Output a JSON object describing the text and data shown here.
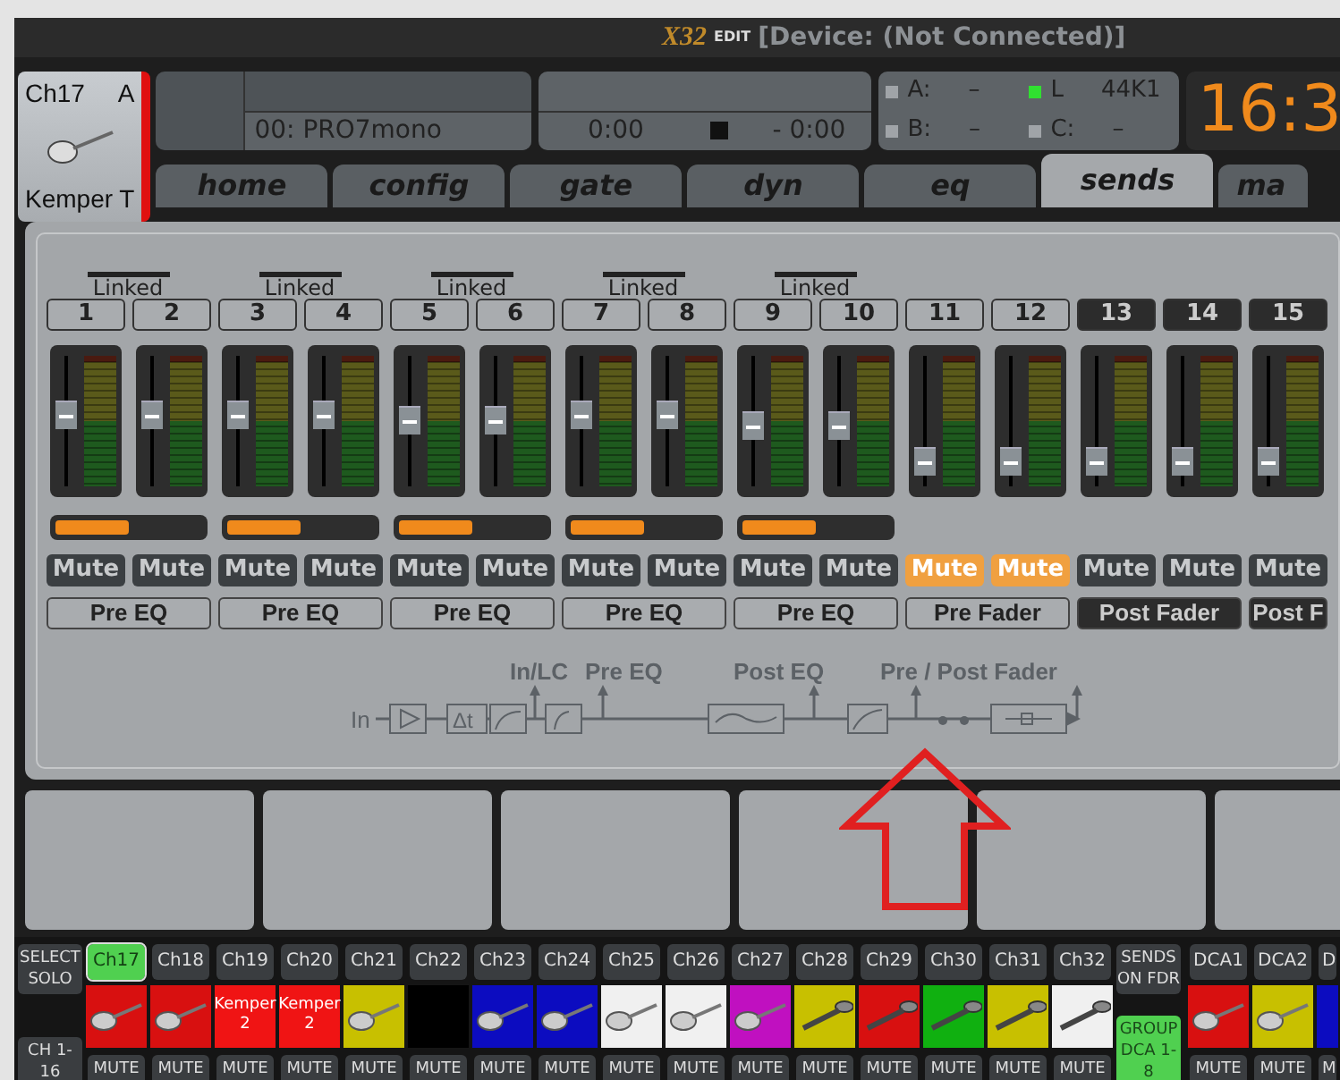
{
  "title_bar": {
    "logo": "X32",
    "logo_sub": "EDIT",
    "title": "[Device: (Not Connected)]"
  },
  "channel": {
    "name": "Ch17",
    "letter": "A",
    "label": "Kemper T"
  },
  "scene": {
    "name": "00: PRO7mono"
  },
  "transport": {
    "elapsed": "0:00",
    "remaining": "- 0:00"
  },
  "status": [
    {
      "label": "A:",
      "value": "–",
      "on": false
    },
    {
      "label": "L",
      "value": "44K1",
      "on": true
    },
    {
      "label": "B:",
      "value": "–",
      "on": false
    },
    {
      "label": "C:",
      "value": "–",
      "on": false
    }
  ],
  "clock": "16:3",
  "tabs": [
    {
      "label": "home",
      "selected": false
    },
    {
      "label": "config",
      "selected": false
    },
    {
      "label": "gate",
      "selected": false
    },
    {
      "label": "dyn",
      "selected": false
    },
    {
      "label": "eq",
      "selected": false
    },
    {
      "label": "sends",
      "selected": true
    },
    {
      "label": "ma",
      "selected": false
    }
  ],
  "bus_pairs": [
    {
      "link_label": "Linked",
      "pan": {
        "level": 0.5
      },
      "tap": "Pre EQ",
      "tap_post": false,
      "buses": [
        {
          "number": "1",
          "level": 0.55,
          "mute": "Mute",
          "muted": false
        },
        {
          "number": "2",
          "level": 0.55,
          "mute": "Mute",
          "muted": false
        }
      ]
    },
    {
      "link_label": "Linked",
      "pan": {
        "level": 0.5
      },
      "tap": "Pre EQ",
      "tap_post": false,
      "buses": [
        {
          "number": "3",
          "level": 0.55,
          "mute": "Mute",
          "muted": false
        },
        {
          "number": "4",
          "level": 0.55,
          "mute": "Mute",
          "muted": false
        }
      ]
    },
    {
      "link_label": "Linked",
      "pan": {
        "level": 0.5
      },
      "tap": "Pre EQ",
      "tap_post": false,
      "buses": [
        {
          "number": "5",
          "level": 0.5,
          "mute": "Mute",
          "muted": false
        },
        {
          "number": "6",
          "level": 0.5,
          "mute": "Mute",
          "muted": false
        }
      ]
    },
    {
      "link_label": "Linked",
      "pan": {
        "level": 0.5
      },
      "tap": "Pre EQ",
      "tap_post": false,
      "buses": [
        {
          "number": "7",
          "level": 0.55,
          "mute": "Mute",
          "muted": false
        },
        {
          "number": "8",
          "level": 0.55,
          "mute": "Mute",
          "muted": false
        }
      ]
    },
    {
      "link_label": "Linked",
      "pan": {
        "level": 0.5
      },
      "tap": "Pre EQ",
      "tap_post": false,
      "buses": [
        {
          "number": "9",
          "level": 0.44,
          "mute": "Mute",
          "muted": false
        },
        {
          "number": "10",
          "level": 0.44,
          "mute": "Mute",
          "muted": false
        }
      ]
    },
    {
      "tap": "Pre Fader",
      "tap_post": false,
      "buses": [
        {
          "number": "11",
          "level": 0.1,
          "mute": "Mute",
          "muted": true
        },
        {
          "number": "12",
          "level": 0.1,
          "mute": "Mute",
          "muted": true
        }
      ]
    },
    {
      "tap": "Post Fader",
      "tap_post": true,
      "buses": [
        {
          "number": "13",
          "level": 0.1,
          "mute": "Mute",
          "muted": false
        },
        {
          "number": "14",
          "level": 0.1,
          "mute": "Mute",
          "muted": false
        }
      ]
    },
    {
      "tap": "Post F",
      "tap_post": true,
      "buses": [
        {
          "number": "15",
          "level": 0.1,
          "mute": "Mute",
          "muted": false
        }
      ]
    }
  ],
  "diagram": {
    "input": "In",
    "delay": "Δt",
    "taps": [
      "In/LC",
      "Pre EQ",
      "Post EQ",
      "Pre / Post Fader"
    ]
  },
  "bottom": {
    "select_solo": "SELECT SOLO",
    "bank": "CH 1-16",
    "sends_on_fader": "SENDS ON FDR",
    "group": {
      "label": "GROUP DCA 1-8",
      "on": true
    },
    "strips": [
      {
        "label": "Ch17",
        "selected": true,
        "color": "#d81010",
        "kind": "guitar",
        "mute": "MUTE"
      },
      {
        "label": "Ch18",
        "selected": false,
        "color": "#d81010",
        "kind": "guitar",
        "mute": "MUTE"
      },
      {
        "label": "Ch19",
        "selected": false,
        "color": "#f01414",
        "name": "Kemper 2",
        "mute": "MUTE"
      },
      {
        "label": "Ch20",
        "selected": false,
        "color": "#f01414",
        "name": "Kemper 2",
        "mute": "MUTE"
      },
      {
        "label": "Ch21",
        "selected": false,
        "color": "#c8c000",
        "kind": "guitar",
        "mute": "MUTE"
      },
      {
        "label": "Ch22",
        "selected": false,
        "color": "#000000",
        "mute": "MUTE"
      },
      {
        "label": "Ch23",
        "selected": false,
        "color": "#0c0cc0",
        "kind": "guitar",
        "mute": "MUTE"
      },
      {
        "label": "Ch24",
        "selected": false,
        "color": "#0c0cc0",
        "kind": "guitar",
        "mute": "MUTE"
      },
      {
        "label": "Ch25",
        "selected": false,
        "color": "#f0f0f0",
        "kind": "guitar",
        "mute": "MUTE"
      },
      {
        "label": "Ch26",
        "selected": false,
        "color": "#f0f0f0",
        "kind": "guitar",
        "mute": "MUTE"
      },
      {
        "label": "Ch27",
        "selected": false,
        "color": "#c010c0",
        "kind": "guitar",
        "mute": "MUTE"
      },
      {
        "label": "Ch28",
        "selected": false,
        "color": "#c8c000",
        "kind": "mic",
        "mute": "MUTE"
      },
      {
        "label": "Ch29",
        "selected": false,
        "color": "#d81010",
        "kind": "mic",
        "mute": "MUTE"
      },
      {
        "label": "Ch30",
        "selected": false,
        "color": "#10b010",
        "kind": "mic",
        "mute": "MUTE"
      },
      {
        "label": "Ch31",
        "selected": false,
        "color": "#c8c000",
        "kind": "mic",
        "mute": "MUTE"
      },
      {
        "label": "Ch32",
        "selected": false,
        "color": "#f0f0f0",
        "kind": "mic",
        "mute": "MUTE"
      }
    ],
    "dcas": [
      {
        "label": "DCA1",
        "selected": false,
        "color": "#d81010",
        "kind": "guitar",
        "mute": "MUTE"
      },
      {
        "label": "DCA2",
        "selected": false,
        "color": "#c8c000",
        "kind": "guitar",
        "mute": "MUTE"
      },
      {
        "label": "D",
        "selected": false,
        "color": "#0c0cc0",
        "mute": "M"
      }
    ]
  }
}
